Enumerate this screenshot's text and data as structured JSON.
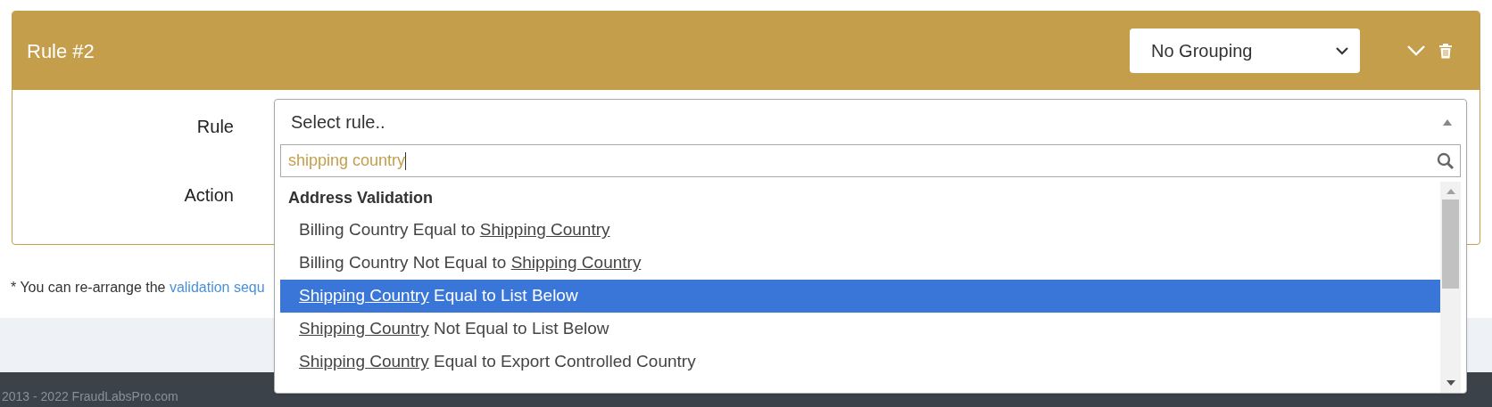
{
  "rule_card": {
    "title": "Rule #2",
    "grouping_select": {
      "value": "No Grouping"
    },
    "fields": [
      {
        "label": "Rule"
      },
      {
        "label": "Action"
      }
    ]
  },
  "rule_dropdown": {
    "placeholder": "Select rule..",
    "search": {
      "value": "shipping country"
    },
    "group": "Address Validation",
    "options": [
      {
        "selected": false,
        "segments": [
          {
            "text": "Billing Country Equal to ",
            "underlined": false
          },
          {
            "text": "Shipping Country",
            "underlined": true
          }
        ]
      },
      {
        "selected": false,
        "segments": [
          {
            "text": "Billing Country Not Equal to ",
            "underlined": false
          },
          {
            "text": "Shipping Country",
            "underlined": true
          }
        ]
      },
      {
        "selected": true,
        "segments": [
          {
            "text": "Shipping Country",
            "underlined": true
          },
          {
            "text": " Equal to List Below",
            "underlined": false
          }
        ]
      },
      {
        "selected": false,
        "segments": [
          {
            "text": "Shipping Country",
            "underlined": true
          },
          {
            "text": " Not Equal to List Below",
            "underlined": false
          }
        ]
      },
      {
        "selected": false,
        "segments": [
          {
            "text": "Shipping Country",
            "underlined": true
          },
          {
            "text": " Equal to Export Controlled Country",
            "underlined": false
          }
        ]
      }
    ]
  },
  "footnote": {
    "text": "* You can re-arrange the ",
    "link": "validation sequ"
  },
  "footer": {
    "copyright": "2013 - 2022 FraudLabsPro.com"
  }
}
